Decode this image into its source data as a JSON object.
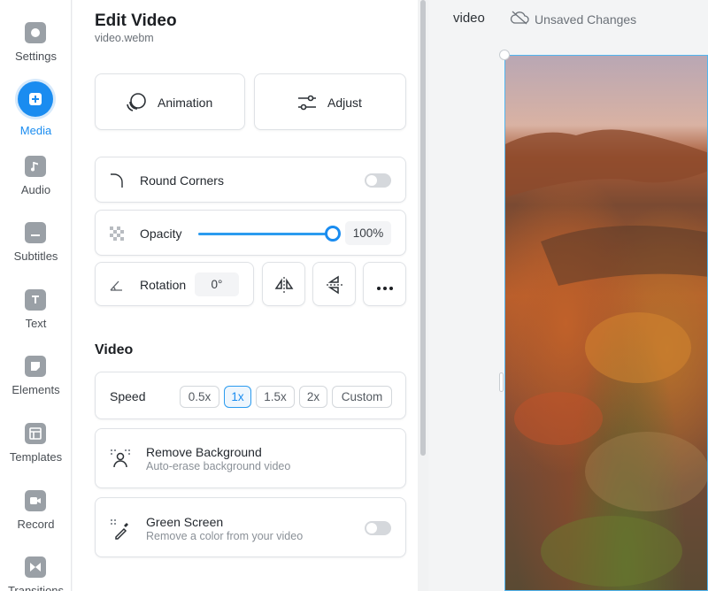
{
  "nav": {
    "items": [
      {
        "label": "Settings",
        "icon": "gear-icon"
      },
      {
        "label": "Media",
        "icon": "plus-icon",
        "active": true
      },
      {
        "label": "Audio",
        "icon": "music-note-icon"
      },
      {
        "label": "Subtitles",
        "icon": "subtitles-icon"
      },
      {
        "label": "Text",
        "icon": "text-icon"
      },
      {
        "label": "Elements",
        "icon": "elements-icon"
      },
      {
        "label": "Templates",
        "icon": "templates-icon"
      },
      {
        "label": "Record",
        "icon": "record-icon"
      },
      {
        "label": "Transitions",
        "icon": "transitions-icon"
      }
    ]
  },
  "panel": {
    "title": "Edit Video",
    "filename": "video.webm",
    "animation_label": "Animation",
    "adjust_label": "Adjust",
    "round_corners_label": "Round Corners",
    "opacity_label": "Opacity",
    "opacity_value": "100%",
    "opacity_level": 1.0,
    "rotation_label": "Rotation",
    "rotation_value": "0°",
    "video_section_title": "Video",
    "speed_label": "Speed",
    "speed_options": [
      "0.5x",
      "1x",
      "1.5x",
      "2x",
      "Custom"
    ],
    "speed_selected": "1x",
    "remove_bg_title": "Remove Background",
    "remove_bg_sub": "Auto-erase background video",
    "green_screen_title": "Green Screen",
    "green_screen_sub": "Remove a color from your video"
  },
  "canvas": {
    "project_name": "video",
    "status": "Unsaved Changes"
  },
  "colors": {
    "accent": "#1a8cf0",
    "frame_border": "#52b6f0"
  }
}
